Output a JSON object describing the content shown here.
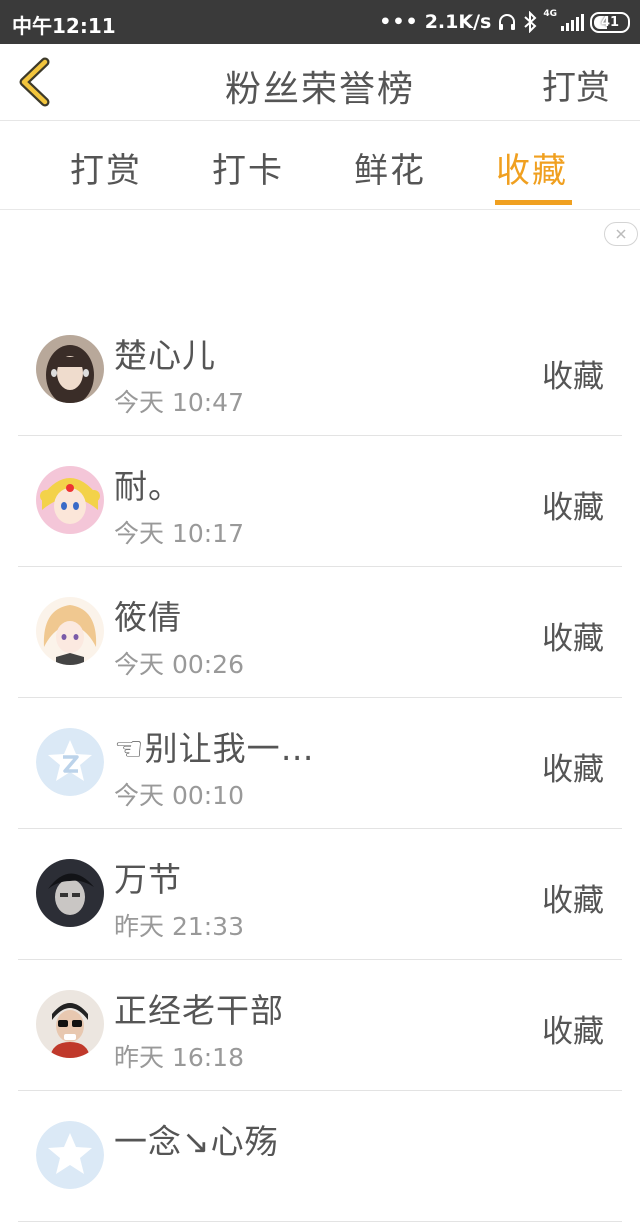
{
  "status_bar": {
    "time": "中午12:11",
    "network_speed": "2.1K/s",
    "network_type": "4G",
    "battery": "41"
  },
  "header": {
    "title": "粉丝荣誉榜",
    "action_label": "打赏",
    "back_icon": "chevron-left-icon",
    "accent_color": "#f0a020"
  },
  "tabs": [
    {
      "label": "打赏",
      "active": false
    },
    {
      "label": "打卡",
      "active": false
    },
    {
      "label": "鲜花",
      "active": false
    },
    {
      "label": "收藏",
      "active": true
    }
  ],
  "ranking": [
    {
      "name": "楚心儿",
      "time": "今天 10:47",
      "action": "收藏",
      "avatar": "avatar-photo-girl"
    },
    {
      "name": "耐。",
      "time": "今天 10:17",
      "action": "收藏",
      "avatar": "avatar-anime-sailor"
    },
    {
      "name": "筱倩",
      "time": "今天 00:26",
      "action": "收藏",
      "avatar": "avatar-anime-blonde"
    },
    {
      "name": "☜别让我一…",
      "time": "今天 00:10",
      "action": "收藏",
      "avatar": "avatar-default-qq"
    },
    {
      "name": "万节",
      "time": "昨天 21:33",
      "action": "收藏",
      "avatar": "avatar-photo-dark"
    },
    {
      "name": "正经老干部",
      "time": "昨天 16:18",
      "action": "收藏",
      "avatar": "avatar-photo-man"
    },
    {
      "name": "一念↘心殇",
      "time": "",
      "action": "",
      "avatar": "avatar-default-qq"
    }
  ]
}
